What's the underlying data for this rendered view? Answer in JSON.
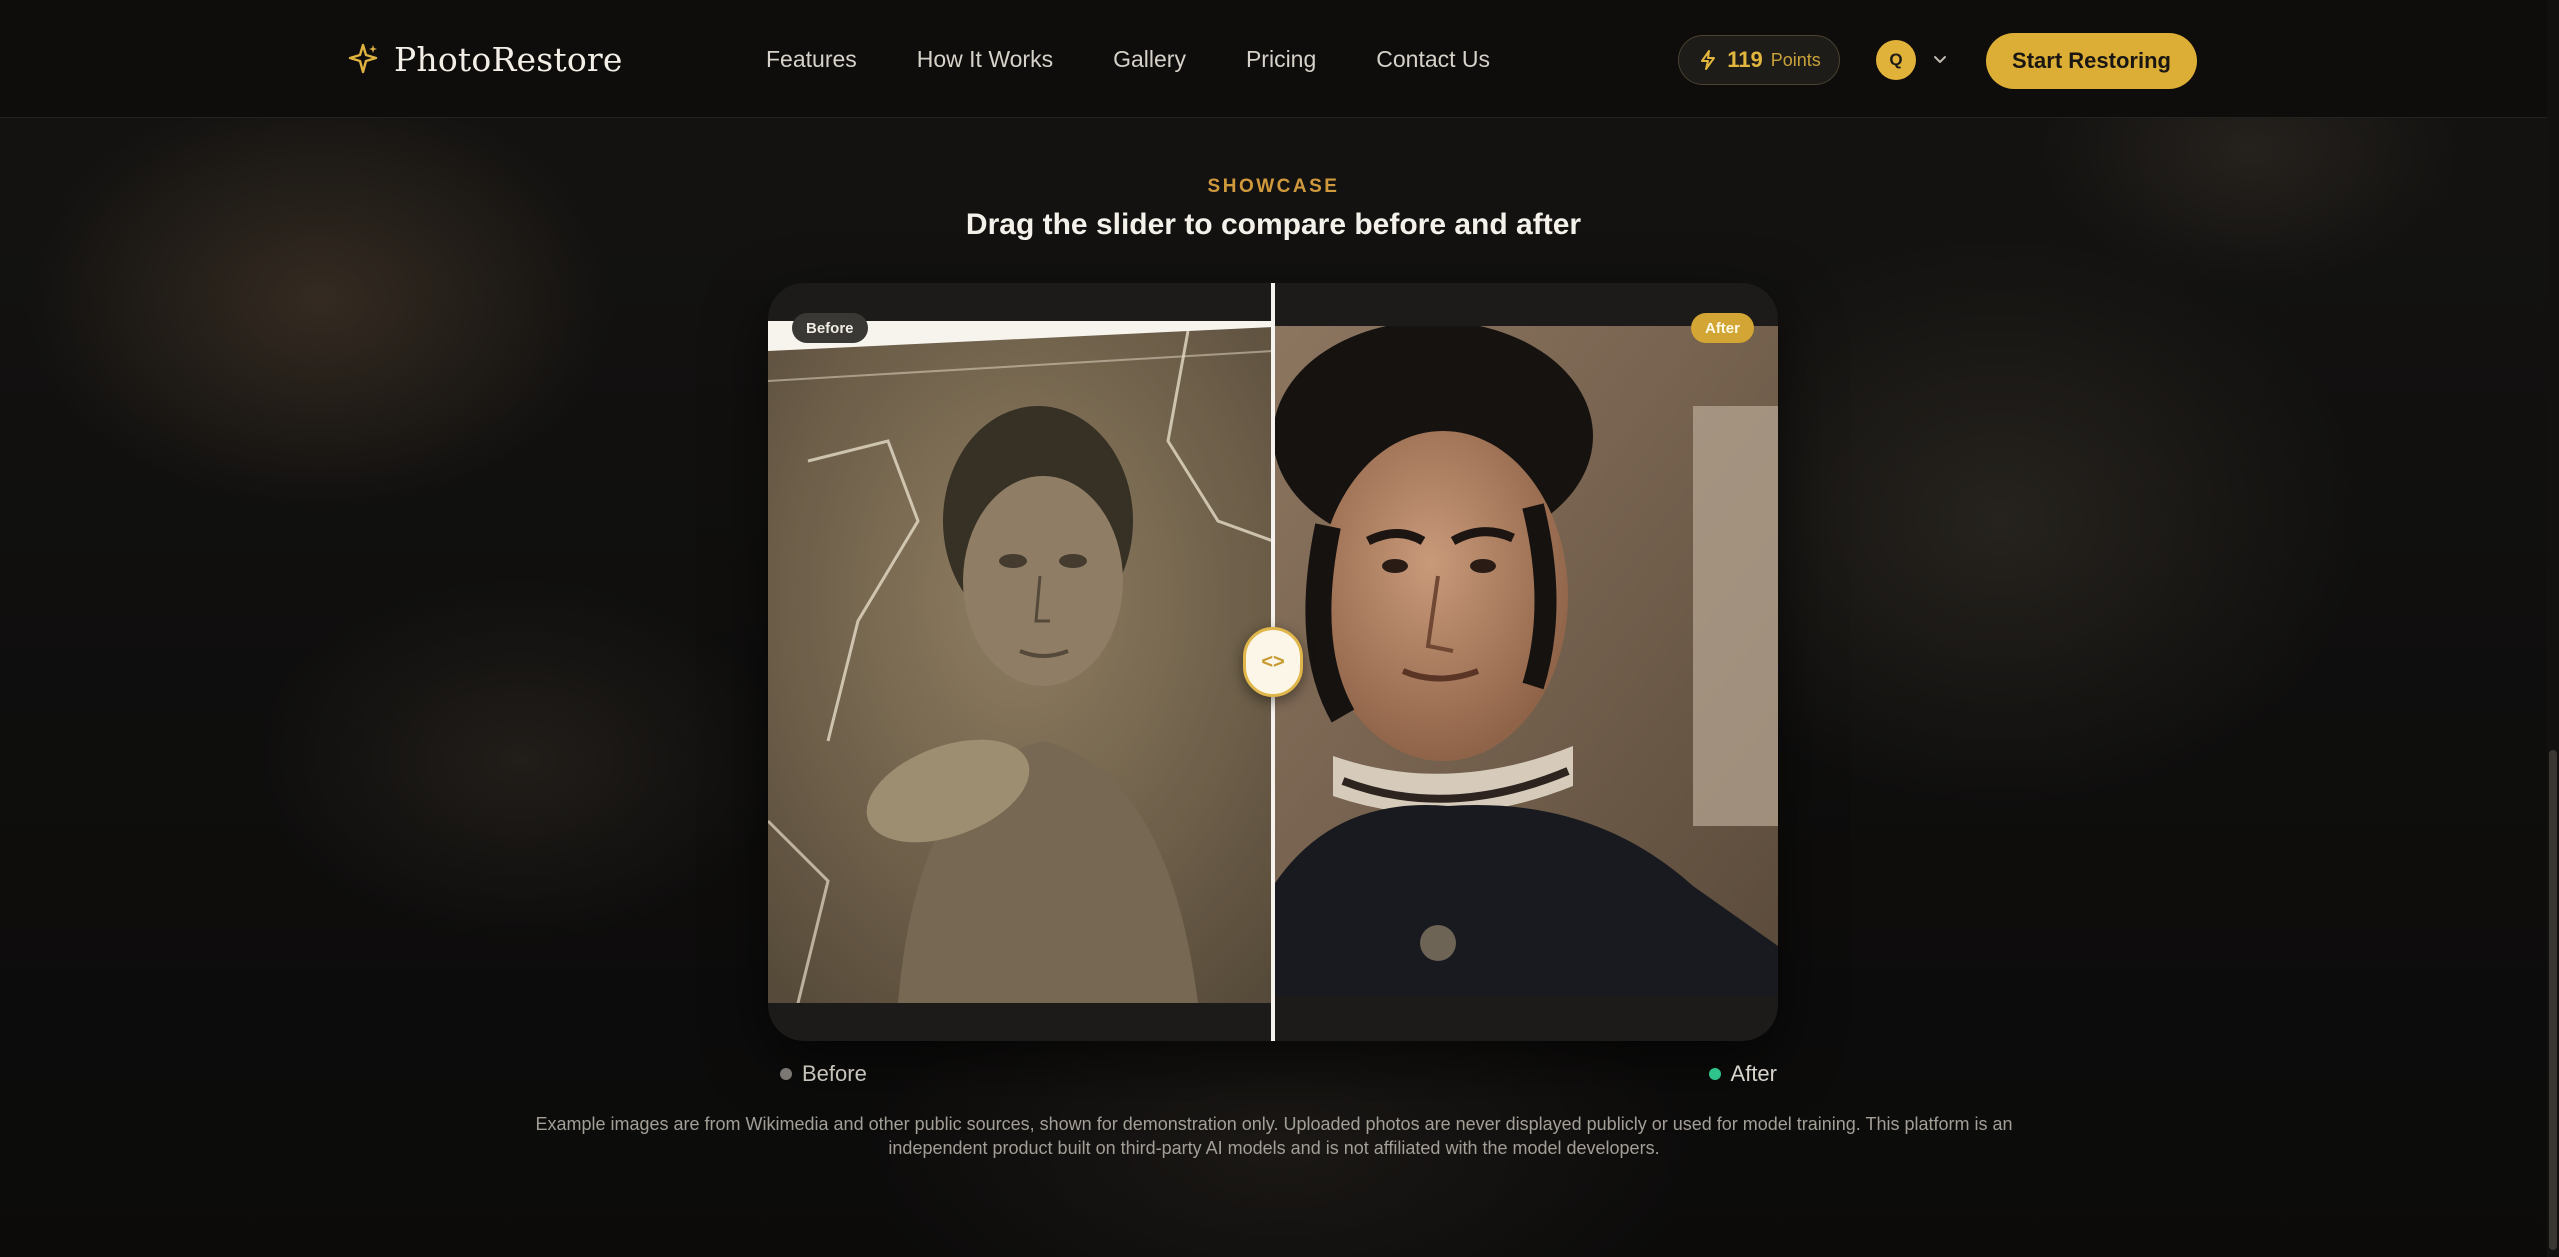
{
  "brand": {
    "name": "PhotoRestore",
    "accent": "#dcae35"
  },
  "nav": {
    "items": [
      {
        "label": "Features"
      },
      {
        "label": "How It Works"
      },
      {
        "label": "Gallery"
      },
      {
        "label": "Pricing"
      },
      {
        "label": "Contact Us"
      }
    ]
  },
  "account": {
    "points_value": "119",
    "points_label": "Points",
    "avatar_initial": "Q",
    "cta_label": "Start Restoring"
  },
  "showcase": {
    "eyebrow": "SHOWCASE",
    "headline": "Drag the slider to compare before and after",
    "badge_before": "Before",
    "badge_after": "After",
    "slider_position": 0.5,
    "handle_glyph": "<>",
    "legend_before": "Before",
    "legend_after": "After",
    "legend_before_color": "#7b7873",
    "legend_after_color": "#2fc48b"
  },
  "footer": {
    "disclaimer": "Example images are from Wikimedia and other public sources, shown for demonstration only. Uploaded photos are never displayed publicly or used for model training. This platform is an independent product built on third-party AI models and is not affiliated with the model developers."
  }
}
